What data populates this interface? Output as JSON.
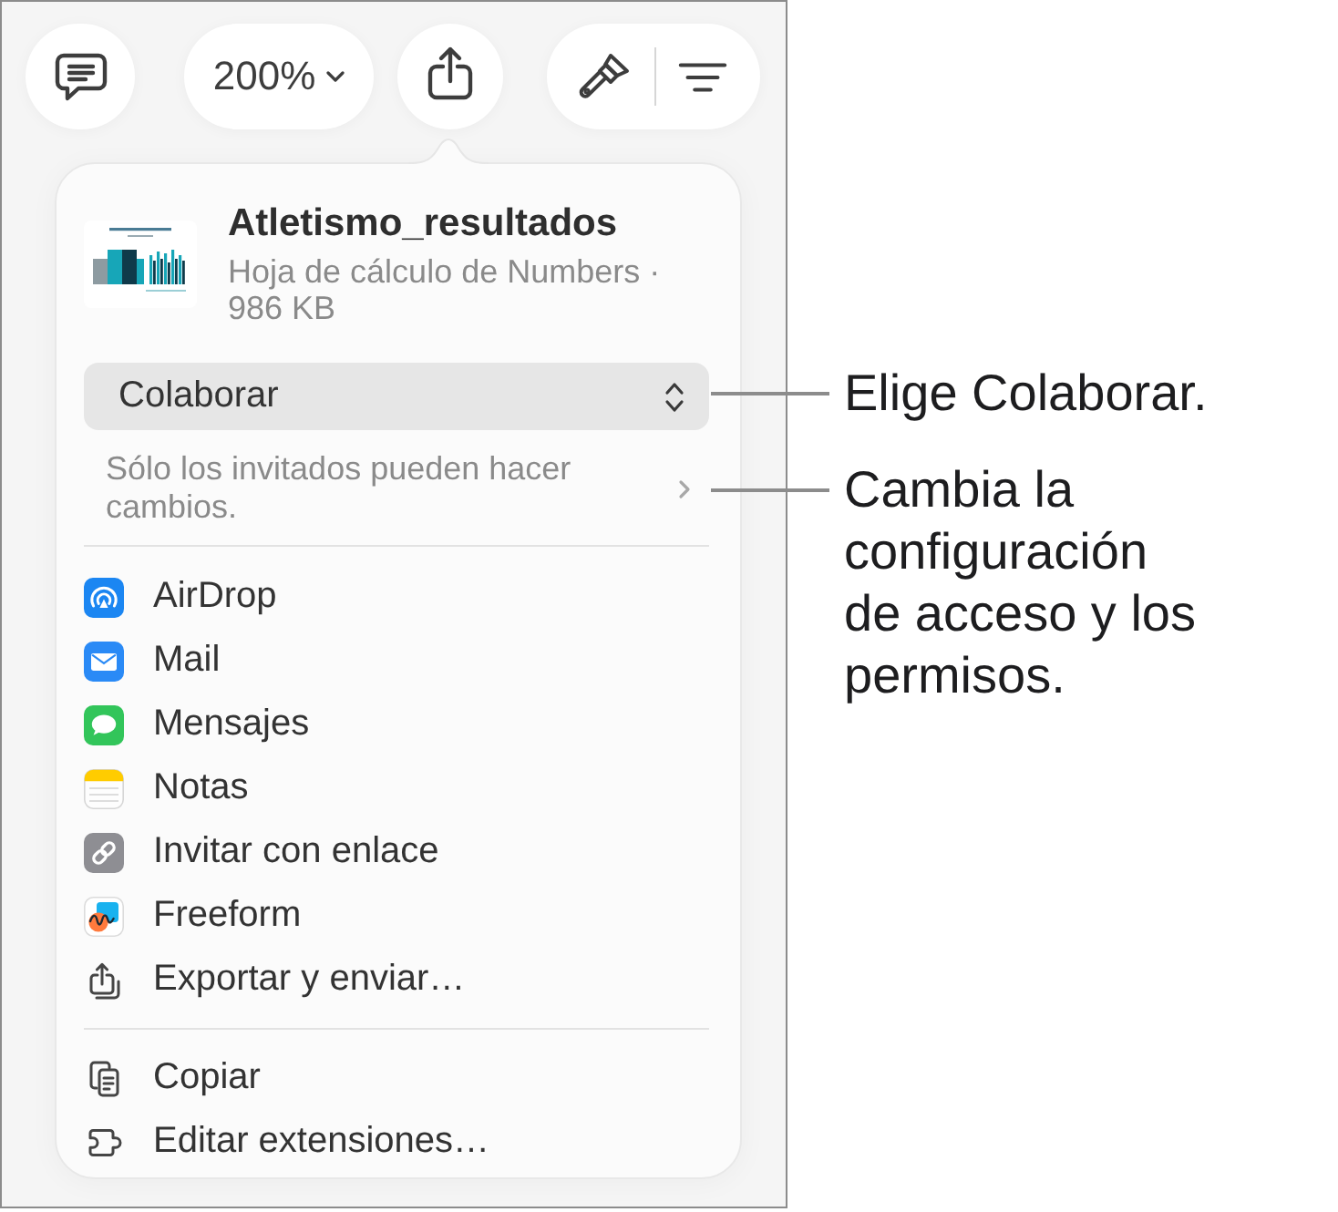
{
  "toolbar": [
    {
      "kind": "comment"
    },
    {
      "kind": "zoom",
      "label": "200%"
    },
    {
      "kind": "share"
    },
    {
      "kind": "format"
    }
  ],
  "share_popover": {
    "document": {
      "title": "Atletismo_resultados",
      "subtitle": "Hoja de cálculo de Numbers · 986 KB"
    },
    "mode_menu": {
      "value": "Colaborar"
    },
    "access": "Sólo los invitados pueden hacer cambios.",
    "targets": [
      {
        "kind": "airdrop",
        "label": "AirDrop"
      },
      {
        "kind": "mail",
        "label": "Mail"
      },
      {
        "kind": "messages",
        "label": "Mensajes"
      },
      {
        "kind": "notes",
        "label": "Notas"
      },
      {
        "kind": "link",
        "label": "Invitar con enlace"
      },
      {
        "kind": "freeform",
        "label": "Freeform"
      },
      {
        "kind": "export",
        "label": "Exportar y enviar…"
      }
    ],
    "actions": [
      {
        "kind": "copy",
        "label": "Copiar"
      },
      {
        "kind": "extensions",
        "label": "Editar extensiones…"
      }
    ]
  },
  "callouts": [
    {
      "text": "Elige Colaborar."
    },
    {
      "text": "Cambia la configuración de acceso y los permisos."
    }
  ]
}
